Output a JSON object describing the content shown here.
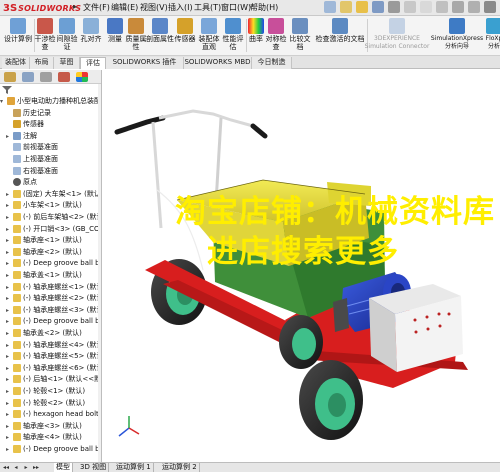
{
  "app": {
    "logo_mark": "3S",
    "logo_text": "SOLIDWORKS",
    "logo_arrow": "▸"
  },
  "menu": [
    "文件(F)",
    "编辑(E)",
    "视图(V)",
    "插入(I)",
    "工具(T)",
    "窗口(W)",
    "帮助(H)"
  ],
  "ribbon": {
    "items": [
      {
        "label": "设计算例",
        "icon": "design-study-icon"
      },
      {
        "label": "干涉检\n查",
        "icon": "interference-check-icon"
      },
      {
        "label": "间隙验\n证",
        "icon": "clearance-verify-icon"
      },
      {
        "label": "孔对齐",
        "icon": "hole-align-icon"
      },
      {
        "label": "测量",
        "icon": "measure-icon"
      },
      {
        "label": "质量属\n性",
        "icon": "mass-properties-icon"
      },
      {
        "label": "剖面属性",
        "icon": "section-properties-icon"
      },
      {
        "label": "传感器",
        "icon": "sensor-icon"
      },
      {
        "label": "装配体\n直观",
        "icon": "assembly-visualization-icon"
      },
      {
        "label": "性能评\n估",
        "icon": "performance-evaluation-icon"
      },
      {
        "label": "曲率",
        "icon": "curvature-icon"
      },
      {
        "label": "对称检\n查",
        "icon": "symmetry-check-icon"
      },
      {
        "label": "比较文\n档",
        "icon": "compare-documents-icon"
      },
      {
        "label": "检查激活的文档",
        "icon": "check-active-document-icon"
      },
      {
        "label": "3DEXPERIENCE\nSimulation Connector",
        "icon": "3dexperience-icon"
      },
      {
        "label": "SimulationXpress\n分析向导",
        "icon": "simulationxpress-icon"
      },
      {
        "label": "FloXp\n分析",
        "icon": "floxpress-icon"
      }
    ]
  },
  "cmd_tabs": [
    "装配体",
    "布局",
    "草图",
    "评估",
    "SOLIDWORKS 插件",
    "SOLIDWORKS MBD",
    "今日制造"
  ],
  "cmd_tabs_active": "评估",
  "tree": [
    {
      "text": "小型电动助力播种机总装配体",
      "icon": "assembly-icon",
      "level": 0,
      "expander": "▾"
    },
    {
      "text": "历史记录",
      "icon": "history-icon",
      "level": 1,
      "expander": ""
    },
    {
      "text": "传感器",
      "icon": "sensor-icon",
      "level": 1,
      "expander": ""
    },
    {
      "text": "注解",
      "icon": "annotation-icon",
      "level": 1,
      "expander": "▸"
    },
    {
      "text": "前视基准面",
      "icon": "plane-icon",
      "level": 1,
      "expander": ""
    },
    {
      "text": "上视基准面",
      "icon": "plane-icon",
      "level": 1,
      "expander": ""
    },
    {
      "text": "右视基准面",
      "icon": "plane-icon",
      "level": 1,
      "expander": ""
    },
    {
      "text": "原点",
      "icon": "origin-icon",
      "level": 1,
      "expander": ""
    },
    {
      "text": "(固定) 大车架<1> (默认",
      "icon": "part-icon",
      "level": 1,
      "expander": "▸"
    },
    {
      "text": "小车架<1> (默认)",
      "icon": "part-icon",
      "level": 1,
      "expander": "▸"
    },
    {
      "text": "(-) 前后车架轴<2> (默认",
      "icon": "part-icon",
      "level": 1,
      "expander": "▸"
    },
    {
      "text": "(-) 开口销<3> (GB_CONF",
      "icon": "part-icon",
      "level": 1,
      "expander": "▸"
    },
    {
      "text": "轴承座<1> (默认)",
      "icon": "part-icon",
      "level": 1,
      "expander": "▸"
    },
    {
      "text": "轴承座<2> (默认)",
      "icon": "part-icon",
      "level": 1,
      "expander": "▸"
    },
    {
      "text": "(-) Deep groove ball be",
      "icon": "part-icon",
      "level": 1,
      "expander": "▸"
    },
    {
      "text": "轴承盖<1> (默认)",
      "icon": "part-icon",
      "level": 1,
      "expander": "▸"
    },
    {
      "text": "(-) 轴承座螺丝<1> (默认)",
      "icon": "part-icon",
      "level": 1,
      "expander": "▸"
    },
    {
      "text": "(-) 轴承座螺丝<2> (默认)",
      "icon": "part-icon",
      "level": 1,
      "expander": "▸"
    },
    {
      "text": "(-) 轴承座螺丝<3> (默认)",
      "icon": "part-icon",
      "level": 1,
      "expander": "▸"
    },
    {
      "text": "(-) Deep groove ball be",
      "icon": "part-icon",
      "level": 1,
      "expander": "▸"
    },
    {
      "text": "轴承盖<2> (默认)",
      "icon": "part-icon",
      "level": 1,
      "expander": "▸"
    },
    {
      "text": "(-) 轴承座螺丝<4> (默认)",
      "icon": "part-icon",
      "level": 1,
      "expander": "▸"
    },
    {
      "text": "(-) 轴承座螺丝<5> (默认)",
      "icon": "part-icon",
      "level": 1,
      "expander": "▸"
    },
    {
      "text": "(-) 轴承座螺丝<6> (默认)",
      "icon": "part-icon",
      "level": 1,
      "expander": "▸"
    },
    {
      "text": "(-) 后轴<1> (默认<<默认",
      "icon": "part-icon",
      "level": 1,
      "expander": "▸"
    },
    {
      "text": "(-) 轮毂<1> (默认)",
      "icon": "part-icon",
      "level": 1,
      "expander": "▸"
    },
    {
      "text": "(-) 轮毂<2> (默认)",
      "icon": "part-icon",
      "level": 1,
      "expander": "▸"
    },
    {
      "text": "(-) hexagon head bolts-",
      "icon": "part-icon",
      "level": 1,
      "expander": "▸"
    },
    {
      "text": "轴承座<3> (默认)",
      "icon": "part-icon",
      "level": 1,
      "expander": "▸"
    },
    {
      "text": "轴承座<4> (默认)",
      "icon": "part-icon",
      "level": 1,
      "expander": "▸"
    },
    {
      "text": "(-) Deep groove ball be",
      "icon": "part-icon",
      "level": 1,
      "expander": "▸"
    }
  ],
  "watermark": {
    "line1": "淘宝店铺：机械资料库",
    "line2": "进店搜索更多"
  },
  "bottom_tabs": [
    "模型",
    "3D 视图",
    "运动算例 1",
    "运动算例 2"
  ],
  "bottom_active": "模型",
  "nav_buttons": [
    "◂◂",
    "◂",
    "▸",
    "▸▸"
  ],
  "colors": {
    "hopper_yellow": "#e8df3a",
    "frame_red": "#d81e1e",
    "body_green": "#3f8f3a",
    "motor_blue": "#2240c8",
    "tire_dark": "#2b2b2b",
    "rim_green": "#3fbf8a",
    "watermark": "#ffee00"
  }
}
